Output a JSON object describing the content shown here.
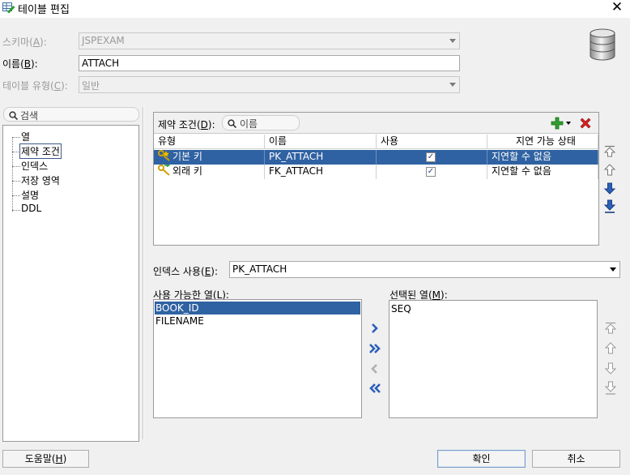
{
  "window": {
    "title": "테이블 편집",
    "close_label": "✕"
  },
  "form": {
    "schema_label_prefix": "스키마(",
    "schema_label_key": "A",
    "schema_label_suffix": "):",
    "schema_value": "JSPEXAM",
    "name_label_prefix": "이름(",
    "name_label_key": "B",
    "name_label_suffix": "):",
    "name_value": "ATTACH",
    "type_label_prefix": "테이블 유형(",
    "type_label_key": "C",
    "type_label_suffix": "):",
    "type_value": "일반"
  },
  "nav": {
    "search_placeholder": "검색",
    "items": [
      {
        "label": "열"
      },
      {
        "label": "제약 조건",
        "selected": true
      },
      {
        "label": "인덱스"
      },
      {
        "label": "저장 영역"
      },
      {
        "label": "설명"
      },
      {
        "label": "DDL"
      }
    ]
  },
  "constraints": {
    "label_prefix": "제약 조건(",
    "label_key": "D",
    "label_suffix": "):",
    "search_placeholder": "이름",
    "columns": [
      "유형",
      "이름",
      "사용",
      "지연 가능 상태"
    ],
    "rows": [
      {
        "type": "기본 키",
        "name": "PK_ATTACH",
        "enabled": true,
        "deferrable": "지연할 수 없음",
        "icon": "primary-key-icon"
      },
      {
        "type": "외래 키",
        "name": "FK_ATTACH",
        "enabled": true,
        "deferrable": "지연할 수 없음",
        "icon": "foreign-key-icon"
      }
    ],
    "check_mark": "✓"
  },
  "index": {
    "label_prefix": "인덱스 사용(",
    "label_key": "E",
    "label_suffix": "):",
    "value": "PK_ATTACH"
  },
  "available_columns": {
    "label_prefix": "사용 가능한 열(",
    "label_key": "L",
    "label_suffix": "):",
    "items": [
      "BOOK_ID",
      "FILENAME"
    ]
  },
  "selected_columns": {
    "label_prefix": "선택된 열(",
    "label_key": "M",
    "label_suffix": "):",
    "items": [
      "SEQ"
    ]
  },
  "buttons": {
    "help": "도움말(H)",
    "help_prefix": "도움말(",
    "help_key": "H",
    "help_suffix": ")",
    "ok": "확인",
    "cancel": "취소"
  },
  "colors": {
    "selection": "#2f62a2",
    "dialog_bg": "#f0f0f0",
    "add_green": "#2e9e2e",
    "delete_red": "#d62020",
    "arrow_blue": "#2c5fb8"
  }
}
